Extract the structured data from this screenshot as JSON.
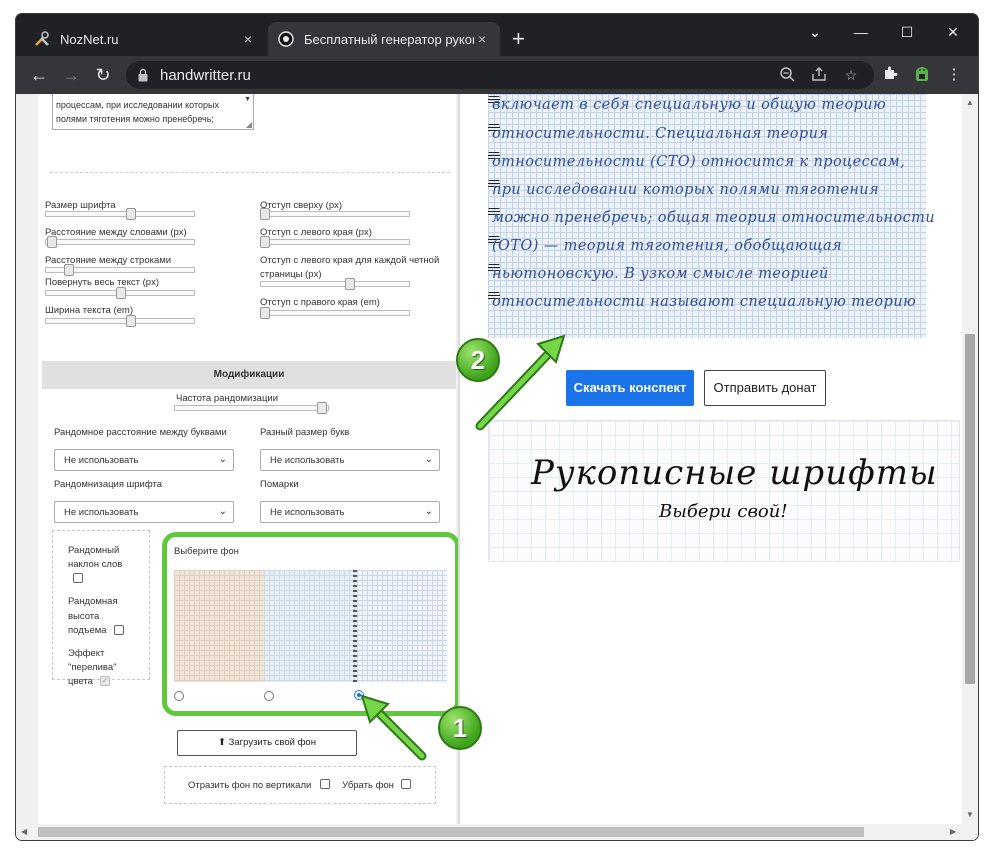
{
  "browser": {
    "tabs": [
      {
        "title": "NozNet.ru",
        "close": "×"
      },
      {
        "title": "Бесплатный генератор рукопис",
        "close": "×"
      }
    ],
    "new_tab": "+",
    "window_controls": {
      "minimize": "—",
      "maximize": "☐",
      "close": "✕",
      "tab_search": "⌄"
    },
    "url": "handwritter.ru"
  },
  "textarea": {
    "line1": "процессам, при исследовании которых",
    "line2": "полями тяготения можно пренебречь;"
  },
  "settings": {
    "font_size": "Размер шрифта",
    "word_spacing": "Расстояние между словами (px)",
    "line_spacing": "Расстояние между строками",
    "rotate": "Повернуть весь текст (px)",
    "text_width": "Ширина текста (em)",
    "top_margin": "Отступ сверху (px)",
    "left_margin": "Отступ с левого края (px)",
    "left_margin_even_1": "Отступ с левого края для каждой четной",
    "left_margin_even_2": "страницы (px)",
    "right_margin": "Отступ с правого края (em)",
    "font_size_level": 0.55,
    "word_spacing_level": 0.05,
    "line_spacing_level": 0.15,
    "rotate_level": 0.5,
    "text_width_level": 0.55,
    "top_margin_level": 0.0,
    "left_margin_level": 0.0,
    "left_margin_even_level": 0.6,
    "right_margin_level": 0.0
  },
  "modifications": {
    "header": "Модификации",
    "randomization_freq": "Частота рандомизации",
    "randomization_freq_level": 0.95,
    "random_letter_spacing": "Рандомное расстояние между буквами",
    "random_letter_size": "Разный размер букв",
    "font_randomization": "Рандомнизация шрифта",
    "blots": "Помарки",
    "not_use": "Не использовать",
    "random_slant_1": "Рандомный",
    "random_slant_2": "наклон слов",
    "random_height_1": "Рандомная",
    "random_height_2": "высота",
    "random_height_3": "подъема",
    "overflow_1": "Эффект",
    "overflow_2": "\"перелива\"",
    "overflow_3": "цвета",
    "choose_bg": "Выберите фон",
    "selected_background_index": 2,
    "upload_bg": "Загрузить свой фон",
    "flip_bg": "Отразить фон по вертикали",
    "remove_bg": "Убрать фон"
  },
  "preview": {
    "lines": [
      "включает в себя специальную и общую теорию",
      "относительности. Специальная теория",
      "относительности (СТО) относится к процессам,",
      "при исследовании которых полями тяготения",
      "можно пренебречь; общая теория относительности",
      "(ОТО) — теория тяготения, обобщающая",
      "ньютоновскую. В узком смысле теорией",
      "относительности называют специальную теорию"
    ],
    "download_button": "Скачать конспект",
    "donate_button": "Отправить донат",
    "banner_title": "Рукописные шрифты",
    "banner_subtitle": "Выбери свой!"
  },
  "callouts": {
    "one": "1",
    "two": "2"
  },
  "colors": {
    "accent": "#1a73e8",
    "highlight": "#5fc83c",
    "ink": "#2e4f96"
  }
}
